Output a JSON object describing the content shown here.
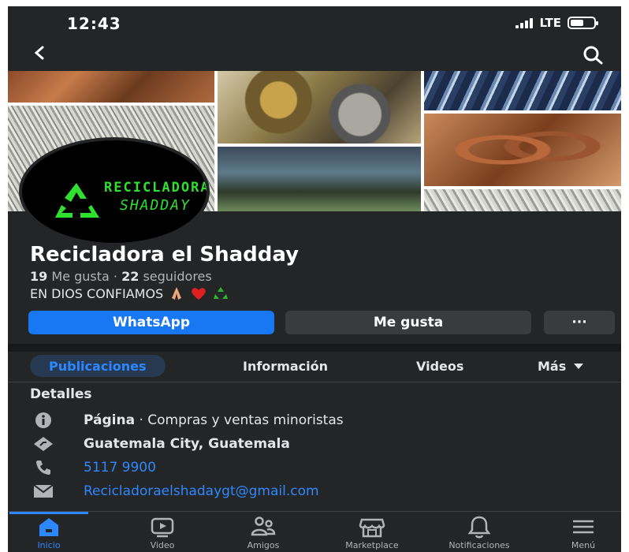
{
  "status": {
    "time": "12:43",
    "network": "LTE"
  },
  "page": {
    "name": "Recicladora el Shadday",
    "likes_count": "19",
    "likes_label": "Me gusta",
    "dot": "·",
    "followers_count": "22",
    "followers_label": "seguidores",
    "motto": "EN DIOS CONFIAMOS",
    "logo_line1": "RECICLADORA",
    "logo_line2": "SHADDAY"
  },
  "actions": {
    "whatsapp": "WhatsApp",
    "like": "Me gusta",
    "more": "···"
  },
  "tabs": [
    {
      "label": "Publicaciones",
      "active": true
    },
    {
      "label": "Información"
    },
    {
      "label": "Videos"
    },
    {
      "label": "Más"
    }
  ],
  "details": {
    "heading": "Detalles",
    "page_label": "Página",
    "page_category": " · Compras y ventas minoristas",
    "location": "Guatemala City, Guatemala",
    "phone": "5117 9900",
    "email": "Recicladoraelshadaygt@gmail.com"
  },
  "bottom_nav": [
    {
      "label": "Inicio",
      "icon": "home-icon",
      "active": true
    },
    {
      "label": "Video",
      "icon": "video-icon"
    },
    {
      "label": "Amigos",
      "icon": "friends-icon"
    },
    {
      "label": "Marketplace",
      "icon": "marketplace-icon"
    },
    {
      "label": "Notificaciones",
      "icon": "bell-icon"
    },
    {
      "label": "Menú",
      "icon": "menu-icon"
    }
  ],
  "colors": {
    "accent": "#1877f2",
    "link": "#2d88ff",
    "background": "#242526",
    "logo_green": "#2fe02f"
  }
}
